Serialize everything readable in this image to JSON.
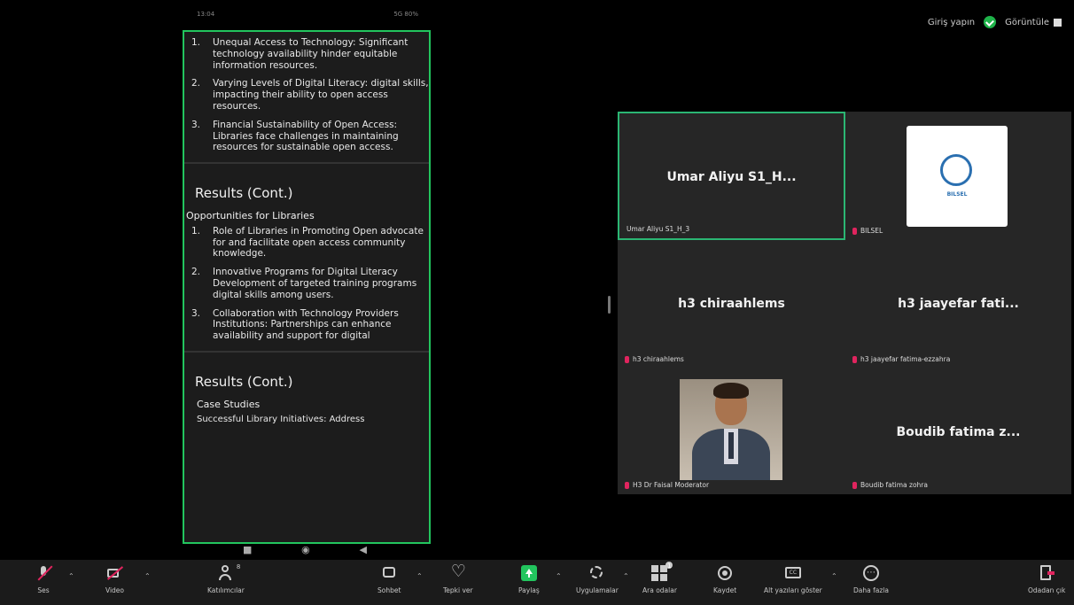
{
  "topbar": {
    "signin_label": "Giriş yapın",
    "view_label": "Görüntüle"
  },
  "phone": {
    "status_time": "13:04",
    "status_right": "5G 80%",
    "slide": {
      "list1": [
        {
          "num": "1.",
          "text": "Unequal Access to Technology: Significant technology availability hinder equitable information resources."
        },
        {
          "num": "2.",
          "text": "Varying Levels of Digital Literacy: digital skills, impacting their ability to open access resources."
        },
        {
          "num": "3.",
          "text": "Financial Sustainability of Open Access: Libraries face challenges in maintaining resources for sustainable open access."
        }
      ],
      "heading1": "Results (Cont.)",
      "sub1": "Opportunities for Libraries",
      "list2": [
        {
          "num": "1.",
          "text": "Role of Libraries in Promoting Open advocate for and facilitate open access community knowledge."
        },
        {
          "num": "2.",
          "text": "Innovative Programs for Digital Literacy Development of targeted training programs digital skills among users."
        },
        {
          "num": "3.",
          "text": "Collaboration with Technology Providers Institutions: Partnerships can enhance availability and support for digital"
        }
      ],
      "heading2": "Results (Cont.)",
      "sub2": "Case Studies",
      "cut_line": "Successful Library Initiatives: Address"
    }
  },
  "gallery": {
    "tiles": [
      {
        "name": "Umar Aliyu S1_H...",
        "label": "Umar Aliyu S1_H_3"
      },
      {
        "name": "",
        "label": "BILSEL",
        "logo_text": "BILSEL"
      },
      {
        "name": "h3 chiraahlems",
        "label": "h3 chiraahlems"
      },
      {
        "name": "h3 jaayefar fati...",
        "label": "h3 jaayefar fatima-ezzahra"
      },
      {
        "name": "",
        "label": "H3 Dr Faisal Moderator"
      },
      {
        "name": "Boudib fatima z...",
        "label": "Boudib fatima zohra"
      }
    ]
  },
  "toolbar": {
    "mute": "Ses",
    "video": "Video",
    "participants": "Katılımcılar",
    "participants_count": "8",
    "chat": "Sohbet",
    "react": "Tepki ver",
    "share": "Paylaş",
    "apps": "Uygulamalar",
    "breakout": "Ara odalar",
    "breakout_badge": "1",
    "record": "Kaydet",
    "captions": "Alt yazıları göster",
    "more": "Daha fazla",
    "leave": "Odadan çık"
  },
  "colors": {
    "active_speaker": "#2bb673",
    "share_border": "#22c55e",
    "mute_red": "#e0245e"
  }
}
